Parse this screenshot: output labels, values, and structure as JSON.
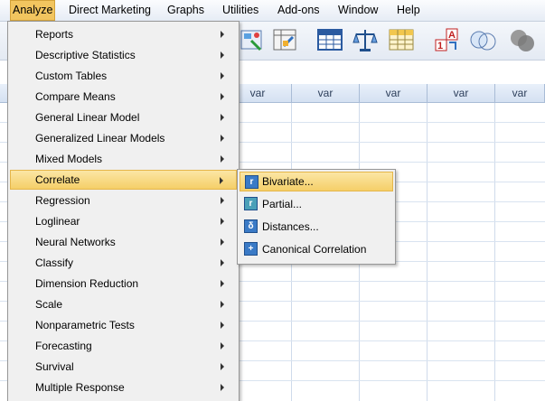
{
  "menubar": {
    "items": [
      "Analyze",
      "Direct Marketing",
      "Graphs",
      "Utilities",
      "Add-ons",
      "Window",
      "Help"
    ]
  },
  "grid": {
    "columns": [
      "var",
      "var",
      "var",
      "var",
      "var"
    ]
  },
  "analyze_menu": {
    "items": [
      "Reports",
      "Descriptive Statistics",
      "Custom Tables",
      "Compare Means",
      "General Linear Model",
      "Generalized Linear Models",
      "Mixed Models",
      "Correlate",
      "Regression",
      "Loglinear",
      "Neural Networks",
      "Classify",
      "Dimension Reduction",
      "Scale",
      "Nonparametric Tests",
      "Forecasting",
      "Survival",
      "Multiple Response"
    ],
    "highlighted": "Correlate"
  },
  "correlate_submenu": {
    "items": [
      "Bivariate...",
      "Partial...",
      "Distances...",
      "Canonical Correlation"
    ],
    "highlighted": "Bivariate...",
    "icons": [
      "bivariate-icon",
      "partial-icon",
      "distances-icon",
      "canonical-correlation-icon"
    ]
  },
  "toolbar": {
    "icons": [
      "chart-builder-icon",
      "select-cases-icon",
      "data-table-icon",
      "scales-icon",
      "grid-icon",
      "value-labels-icon",
      "sets-icon",
      "circles-icon"
    ]
  },
  "colors": {
    "menu_highlight": "#f5cf68",
    "active_menu": "#f2c55f",
    "header_blue": "#d5e1f2"
  }
}
